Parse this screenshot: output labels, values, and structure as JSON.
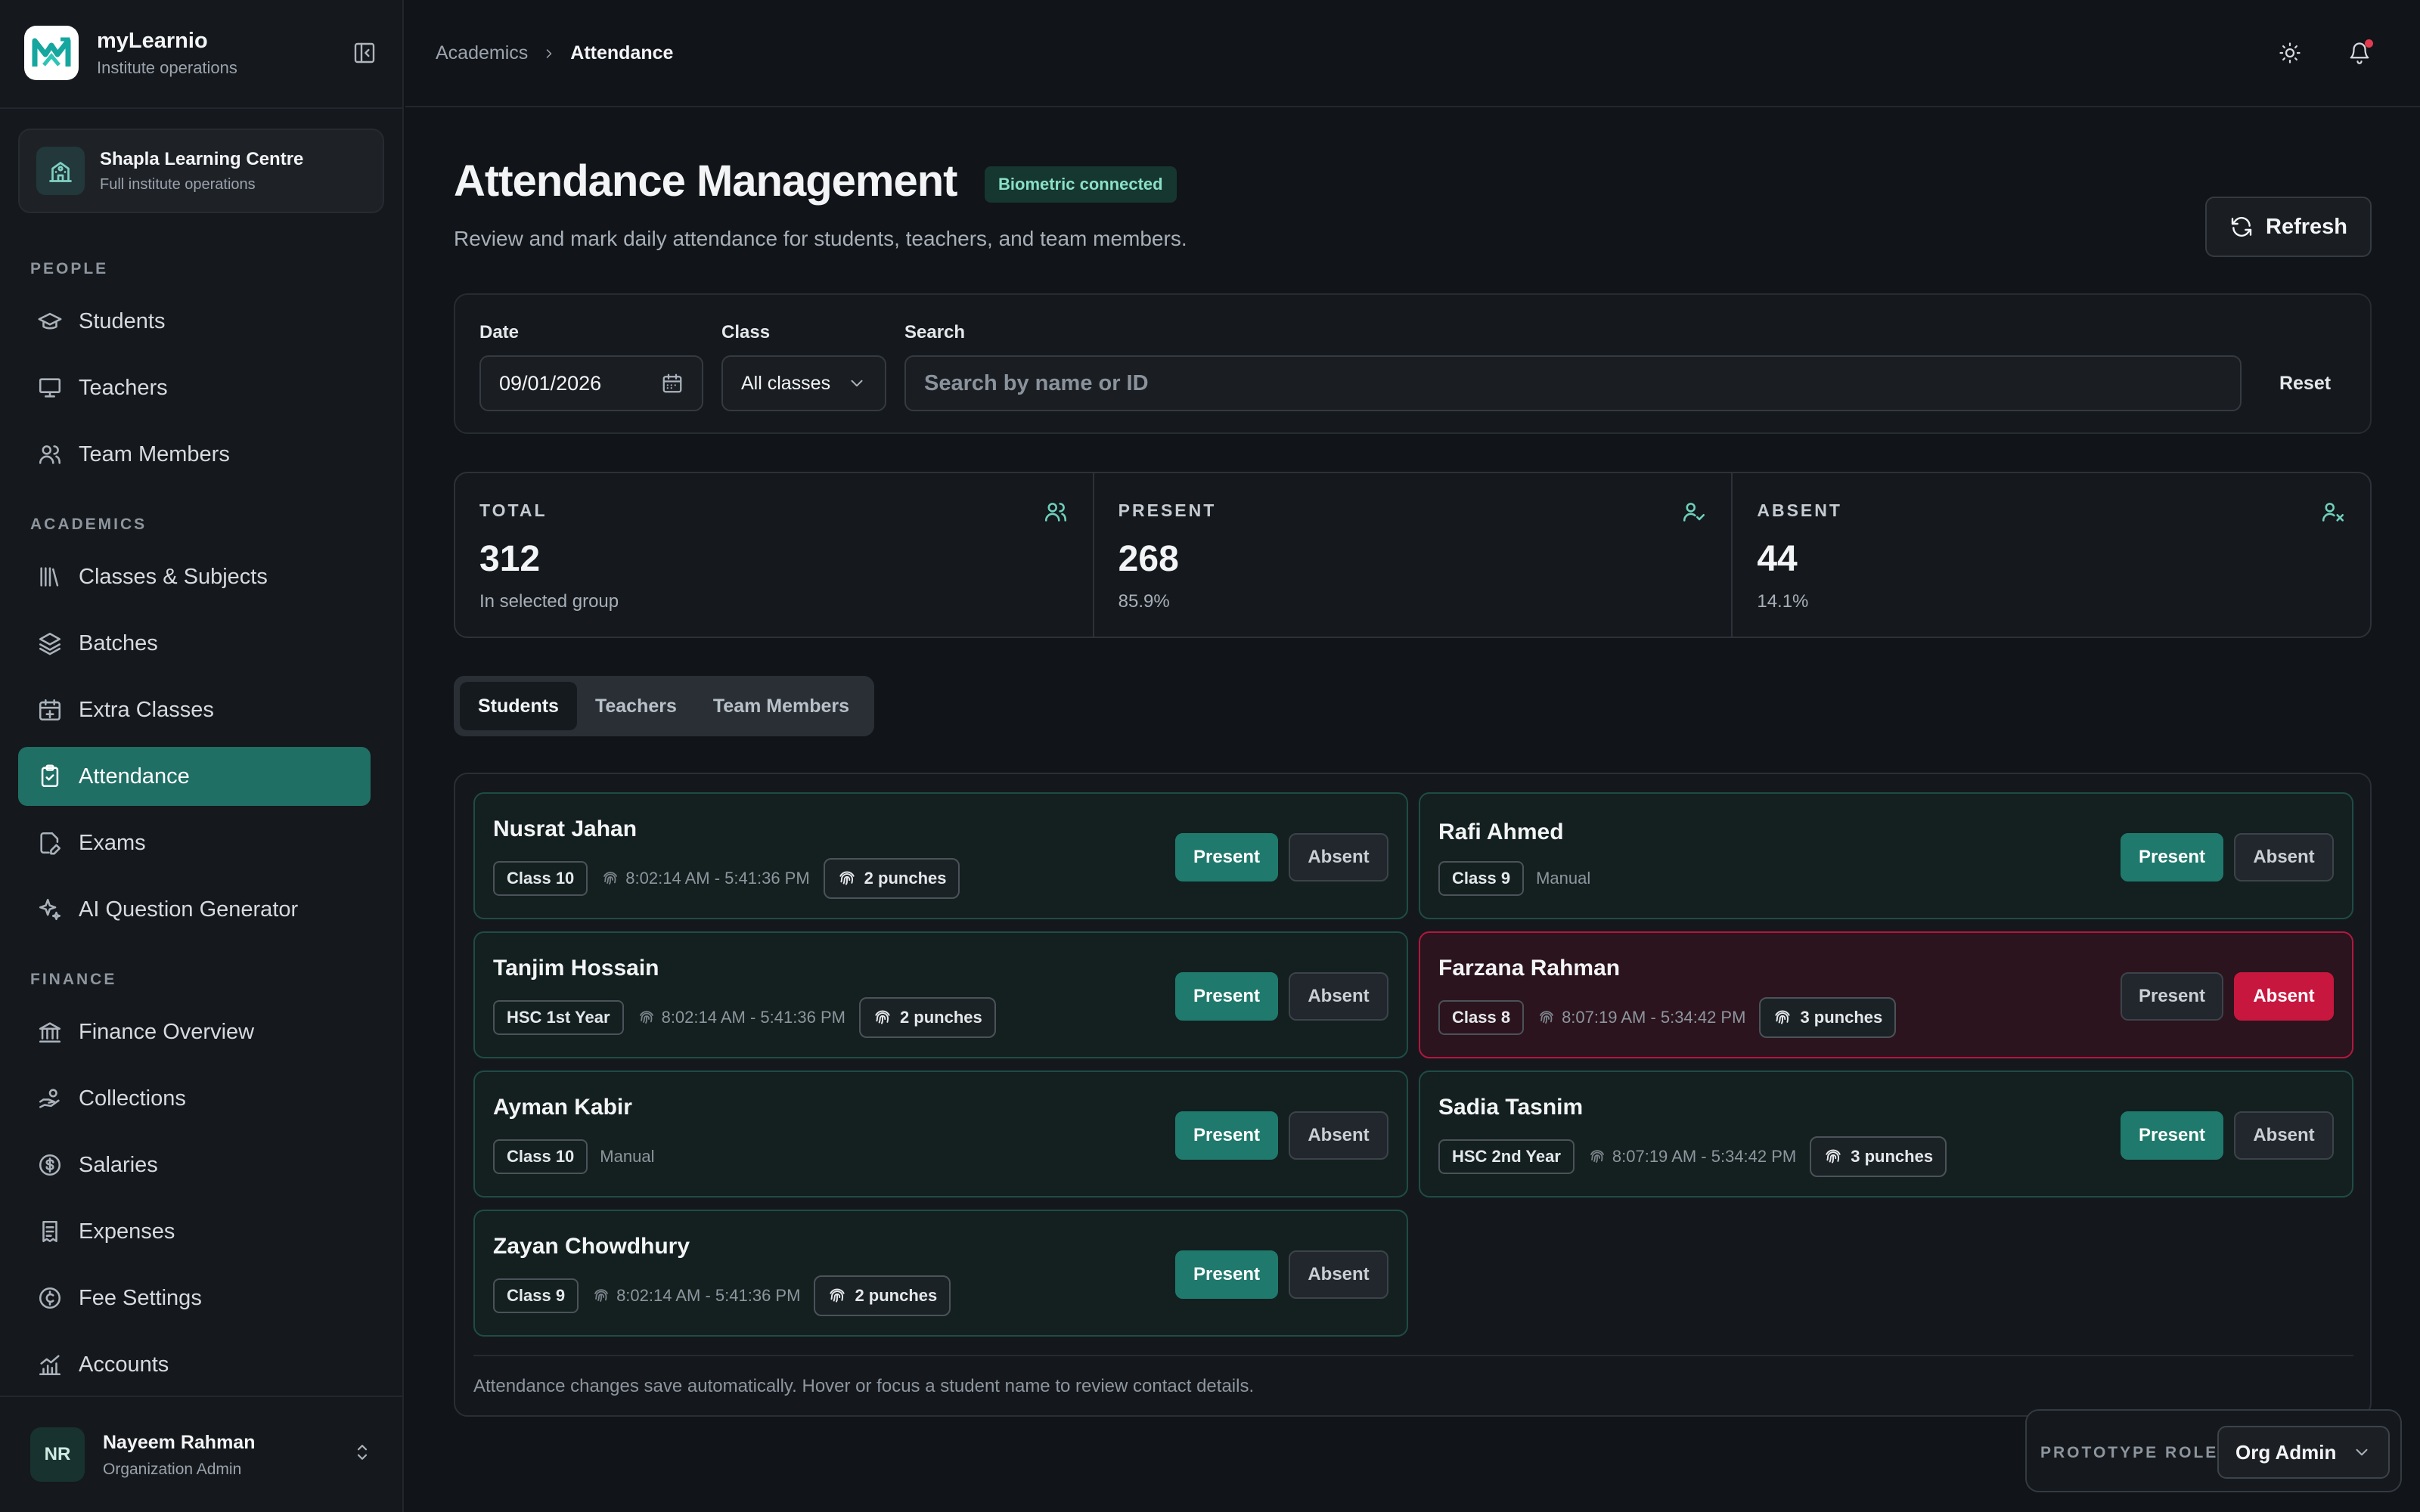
{
  "brand": {
    "name": "myLearnio",
    "subtitle": "Institute operations"
  },
  "org": {
    "name": "Shapla Learning Centre",
    "subtitle": "Full institute operations"
  },
  "nav": {
    "sections": [
      {
        "title": "PEOPLE",
        "items": [
          {
            "label": "Students",
            "icon": "graduation-cap-icon"
          },
          {
            "label": "Teachers",
            "icon": "presentation-board-icon"
          },
          {
            "label": "Team Members",
            "icon": "users-icon"
          }
        ]
      },
      {
        "title": "ACADEMICS",
        "items": [
          {
            "label": "Classes & Subjects",
            "icon": "library-icon"
          },
          {
            "label": "Batches",
            "icon": "layers-icon"
          },
          {
            "label": "Extra Classes",
            "icon": "calendar-plus-icon"
          },
          {
            "label": "Attendance",
            "icon": "clipboard-check-icon",
            "active": true
          },
          {
            "label": "Exams",
            "icon": "file-pen-icon"
          },
          {
            "label": "AI Question Generator",
            "icon": "sparkles-icon"
          }
        ]
      },
      {
        "title": "FINANCE",
        "items": [
          {
            "label": "Finance Overview",
            "icon": "landmark-icon"
          },
          {
            "label": "Collections",
            "icon": "hand-coins-icon"
          },
          {
            "label": "Salaries",
            "icon": "dollar-circle-icon"
          },
          {
            "label": "Expenses",
            "icon": "receipt-icon"
          },
          {
            "label": "Fee Settings",
            "icon": "badge-cent-icon"
          },
          {
            "label": "Accounts",
            "icon": "chart-icon"
          }
        ]
      }
    ]
  },
  "user": {
    "initials": "NR",
    "name": "Nayeem Rahman",
    "role": "Organization Admin"
  },
  "breadcrumb": {
    "parent": "Academics",
    "current": "Attendance"
  },
  "header": {
    "title": "Attendance Management",
    "badge": "Biometric connected",
    "subtitle": "Review and mark daily attendance for students, teachers, and team members.",
    "refresh_label": "Refresh"
  },
  "filters": {
    "date_label": "Date",
    "date_value": "09/01/2026",
    "class_label": "Class",
    "class_value": "All classes",
    "search_label": "Search",
    "search_placeholder": "Search by name or ID",
    "reset_label": "Reset"
  },
  "stats": [
    {
      "label": "TOTAL",
      "value": "312",
      "note": "In selected group",
      "icon": "users-icon"
    },
    {
      "label": "PRESENT",
      "value": "268",
      "note": "85.9%",
      "icon": "user-check-icon"
    },
    {
      "label": "ABSENT",
      "value": "44",
      "note": "14.1%",
      "icon": "user-x-icon"
    }
  ],
  "tabs": [
    {
      "label": "Students",
      "active": true
    },
    {
      "label": "Teachers"
    },
    {
      "label": "Team Members"
    }
  ],
  "records": [
    {
      "name": "Nusrat Jahan",
      "class": "Class 10",
      "time": "8:02:14 AM - 5:41:36 PM",
      "punches": "2 punches",
      "status": "present"
    },
    {
      "name": "Rafi Ahmed",
      "class": "Class 9",
      "manual": "Manual",
      "status": "present"
    },
    {
      "name": "Tanjim Hossain",
      "class": "HSC 1st Year",
      "time": "8:02:14 AM - 5:41:36 PM",
      "punches": "2 punches",
      "status": "present"
    },
    {
      "name": "Farzana Rahman",
      "class": "Class 8",
      "time": "8:07:19 AM - 5:34:42 PM",
      "punches": "3 punches",
      "status": "absent"
    },
    {
      "name": "Ayman Kabir",
      "class": "Class 10",
      "manual": "Manual",
      "status": "present"
    },
    {
      "name": "Sadia Tasnim",
      "class": "HSC 2nd Year",
      "time": "8:07:19 AM - 5:34:42 PM",
      "punches": "3 punches",
      "status": "present"
    },
    {
      "name": "Zayan Chowdhury",
      "class": "Class 9",
      "time": "8:02:14 AM - 5:41:36 PM",
      "punches": "2 punches",
      "status": "present"
    }
  ],
  "buttons": {
    "present": "Present",
    "absent": "Absent"
  },
  "footer_note": "Attendance changes save automatically. Hover or focus a student name to review contact details.",
  "prototype": {
    "label": "PROTOTYPE ROLE",
    "value": "Org Admin"
  },
  "colors": {
    "accent": "#1f7a6d",
    "absent": "#c8173f",
    "background": "#111418"
  }
}
